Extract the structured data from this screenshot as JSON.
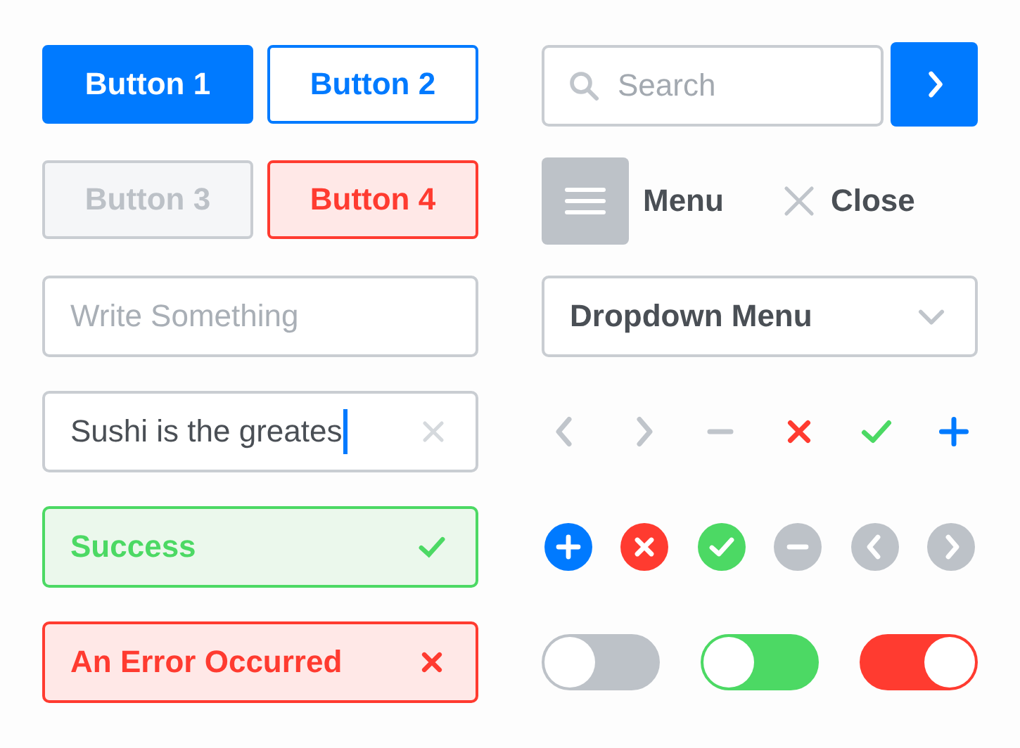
{
  "buttons": [
    {
      "label": "Button 1",
      "kind": "primary"
    },
    {
      "label": "Button 2",
      "kind": "outline"
    },
    {
      "label": "Button 3",
      "kind": "disabled"
    },
    {
      "label": "Button 4",
      "kind": "danger"
    }
  ],
  "empty_field": {
    "placeholder": "Write Something"
  },
  "filled_field": {
    "value": "Sushi is the greates"
  },
  "alerts": [
    {
      "kind": "success",
      "text": "Success"
    },
    {
      "kind": "error",
      "text": "An Error Occurred"
    }
  ],
  "search": {
    "placeholder": "Search"
  },
  "menu": {
    "label": "Menu"
  },
  "close": {
    "label": "Close"
  },
  "dropdown": {
    "value": "Dropdown Menu"
  },
  "plain_icons": [
    {
      "kind": "prev",
      "color": "#c0c5cb"
    },
    {
      "kind": "next",
      "color": "#c0c5cb"
    },
    {
      "kind": "minus",
      "color": "#c0c5cb"
    },
    {
      "kind": "close",
      "color": "#ff3b30"
    },
    {
      "kind": "check",
      "color": "#4cd964"
    },
    {
      "kind": "plus",
      "color": "#007aff"
    }
  ],
  "circle_icons": [
    {
      "kind": "plus",
      "color": "#007aff"
    },
    {
      "kind": "close",
      "color": "#ff3b30"
    },
    {
      "kind": "check",
      "color": "#4cd964"
    },
    {
      "kind": "minus",
      "color": "#bdc2c8"
    },
    {
      "kind": "prev",
      "color": "#bdc2c8"
    },
    {
      "kind": "next",
      "color": "#bdc2c8"
    }
  ],
  "toggles": [
    {
      "on": false,
      "color": "#bdc2c8"
    },
    {
      "on": false,
      "color": "#4cd964"
    },
    {
      "on": true,
      "color": "#ff3b30"
    }
  ]
}
